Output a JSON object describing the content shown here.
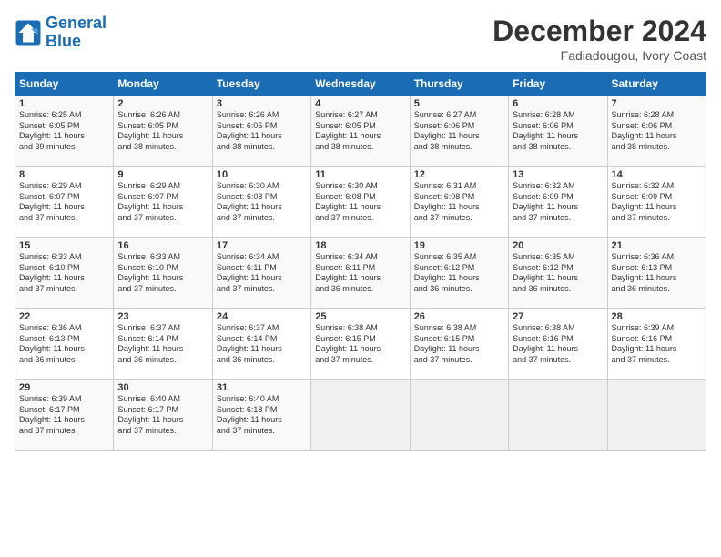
{
  "header": {
    "logo_line1": "General",
    "logo_line2": "Blue",
    "month_title": "December 2024",
    "subtitle": "Fadiadougou, Ivory Coast"
  },
  "days_of_week": [
    "Sunday",
    "Monday",
    "Tuesday",
    "Wednesday",
    "Thursday",
    "Friday",
    "Saturday"
  ],
  "weeks": [
    [
      {
        "day": "1",
        "info": "Sunrise: 6:25 AM\nSunset: 6:05 PM\nDaylight: 11 hours\nand 39 minutes."
      },
      {
        "day": "2",
        "info": "Sunrise: 6:26 AM\nSunset: 6:05 PM\nDaylight: 11 hours\nand 38 minutes."
      },
      {
        "day": "3",
        "info": "Sunrise: 6:26 AM\nSunset: 6:05 PM\nDaylight: 11 hours\nand 38 minutes."
      },
      {
        "day": "4",
        "info": "Sunrise: 6:27 AM\nSunset: 6:05 PM\nDaylight: 11 hours\nand 38 minutes."
      },
      {
        "day": "5",
        "info": "Sunrise: 6:27 AM\nSunset: 6:06 PM\nDaylight: 11 hours\nand 38 minutes."
      },
      {
        "day": "6",
        "info": "Sunrise: 6:28 AM\nSunset: 6:06 PM\nDaylight: 11 hours\nand 38 minutes."
      },
      {
        "day": "7",
        "info": "Sunrise: 6:28 AM\nSunset: 6:06 PM\nDaylight: 11 hours\nand 38 minutes."
      }
    ],
    [
      {
        "day": "8",
        "info": "Sunrise: 6:29 AM\nSunset: 6:07 PM\nDaylight: 11 hours\nand 37 minutes."
      },
      {
        "day": "9",
        "info": "Sunrise: 6:29 AM\nSunset: 6:07 PM\nDaylight: 11 hours\nand 37 minutes."
      },
      {
        "day": "10",
        "info": "Sunrise: 6:30 AM\nSunset: 6:08 PM\nDaylight: 11 hours\nand 37 minutes."
      },
      {
        "day": "11",
        "info": "Sunrise: 6:30 AM\nSunset: 6:08 PM\nDaylight: 11 hours\nand 37 minutes."
      },
      {
        "day": "12",
        "info": "Sunrise: 6:31 AM\nSunset: 6:08 PM\nDaylight: 11 hours\nand 37 minutes."
      },
      {
        "day": "13",
        "info": "Sunrise: 6:32 AM\nSunset: 6:09 PM\nDaylight: 11 hours\nand 37 minutes."
      },
      {
        "day": "14",
        "info": "Sunrise: 6:32 AM\nSunset: 6:09 PM\nDaylight: 11 hours\nand 37 minutes."
      }
    ],
    [
      {
        "day": "15",
        "info": "Sunrise: 6:33 AM\nSunset: 6:10 PM\nDaylight: 11 hours\nand 37 minutes."
      },
      {
        "day": "16",
        "info": "Sunrise: 6:33 AM\nSunset: 6:10 PM\nDaylight: 11 hours\nand 37 minutes."
      },
      {
        "day": "17",
        "info": "Sunrise: 6:34 AM\nSunset: 6:11 PM\nDaylight: 11 hours\nand 37 minutes."
      },
      {
        "day": "18",
        "info": "Sunrise: 6:34 AM\nSunset: 6:11 PM\nDaylight: 11 hours\nand 36 minutes."
      },
      {
        "day": "19",
        "info": "Sunrise: 6:35 AM\nSunset: 6:12 PM\nDaylight: 11 hours\nand 36 minutes."
      },
      {
        "day": "20",
        "info": "Sunrise: 6:35 AM\nSunset: 6:12 PM\nDaylight: 11 hours\nand 36 minutes."
      },
      {
        "day": "21",
        "info": "Sunrise: 6:36 AM\nSunset: 6:13 PM\nDaylight: 11 hours\nand 36 minutes."
      }
    ],
    [
      {
        "day": "22",
        "info": "Sunrise: 6:36 AM\nSunset: 6:13 PM\nDaylight: 11 hours\nand 36 minutes."
      },
      {
        "day": "23",
        "info": "Sunrise: 6:37 AM\nSunset: 6:14 PM\nDaylight: 11 hours\nand 36 minutes."
      },
      {
        "day": "24",
        "info": "Sunrise: 6:37 AM\nSunset: 6:14 PM\nDaylight: 11 hours\nand 36 minutes."
      },
      {
        "day": "25",
        "info": "Sunrise: 6:38 AM\nSunset: 6:15 PM\nDaylight: 11 hours\nand 37 minutes."
      },
      {
        "day": "26",
        "info": "Sunrise: 6:38 AM\nSunset: 6:15 PM\nDaylight: 11 hours\nand 37 minutes."
      },
      {
        "day": "27",
        "info": "Sunrise: 6:38 AM\nSunset: 6:16 PM\nDaylight: 11 hours\nand 37 minutes."
      },
      {
        "day": "28",
        "info": "Sunrise: 6:39 AM\nSunset: 6:16 PM\nDaylight: 11 hours\nand 37 minutes."
      }
    ],
    [
      {
        "day": "29",
        "info": "Sunrise: 6:39 AM\nSunset: 6:17 PM\nDaylight: 11 hours\nand 37 minutes."
      },
      {
        "day": "30",
        "info": "Sunrise: 6:40 AM\nSunset: 6:17 PM\nDaylight: 11 hours\nand 37 minutes."
      },
      {
        "day": "31",
        "info": "Sunrise: 6:40 AM\nSunset: 6:18 PM\nDaylight: 11 hours\nand 37 minutes."
      },
      {
        "day": "",
        "info": ""
      },
      {
        "day": "",
        "info": ""
      },
      {
        "day": "",
        "info": ""
      },
      {
        "day": "",
        "info": ""
      }
    ]
  ]
}
